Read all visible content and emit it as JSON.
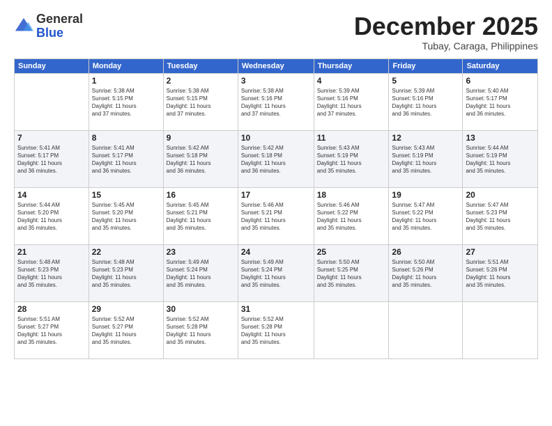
{
  "header": {
    "logo": {
      "general": "General",
      "blue": "Blue"
    },
    "title": "December 2025",
    "location": "Tubay, Caraga, Philippines"
  },
  "weekdays": [
    "Sunday",
    "Monday",
    "Tuesday",
    "Wednesday",
    "Thursday",
    "Friday",
    "Saturday"
  ],
  "weeks": [
    [
      {
        "day": "",
        "info": ""
      },
      {
        "day": "1",
        "info": "Sunrise: 5:38 AM\nSunset: 5:15 PM\nDaylight: 11 hours\nand 37 minutes."
      },
      {
        "day": "2",
        "info": "Sunrise: 5:38 AM\nSunset: 5:15 PM\nDaylight: 11 hours\nand 37 minutes."
      },
      {
        "day": "3",
        "info": "Sunrise: 5:38 AM\nSunset: 5:16 PM\nDaylight: 11 hours\nand 37 minutes."
      },
      {
        "day": "4",
        "info": "Sunrise: 5:39 AM\nSunset: 5:16 PM\nDaylight: 11 hours\nand 37 minutes."
      },
      {
        "day": "5",
        "info": "Sunrise: 5:39 AM\nSunset: 5:16 PM\nDaylight: 11 hours\nand 36 minutes."
      },
      {
        "day": "6",
        "info": "Sunrise: 5:40 AM\nSunset: 5:17 PM\nDaylight: 11 hours\nand 36 minutes."
      }
    ],
    [
      {
        "day": "7",
        "info": "Sunrise: 5:41 AM\nSunset: 5:17 PM\nDaylight: 11 hours\nand 36 minutes."
      },
      {
        "day": "8",
        "info": "Sunrise: 5:41 AM\nSunset: 5:17 PM\nDaylight: 11 hours\nand 36 minutes."
      },
      {
        "day": "9",
        "info": "Sunrise: 5:42 AM\nSunset: 5:18 PM\nDaylight: 11 hours\nand 36 minutes."
      },
      {
        "day": "10",
        "info": "Sunrise: 5:42 AM\nSunset: 5:18 PM\nDaylight: 11 hours\nand 36 minutes."
      },
      {
        "day": "11",
        "info": "Sunrise: 5:43 AM\nSunset: 5:19 PM\nDaylight: 11 hours\nand 35 minutes."
      },
      {
        "day": "12",
        "info": "Sunrise: 5:43 AM\nSunset: 5:19 PM\nDaylight: 11 hours\nand 35 minutes."
      },
      {
        "day": "13",
        "info": "Sunrise: 5:44 AM\nSunset: 5:19 PM\nDaylight: 11 hours\nand 35 minutes."
      }
    ],
    [
      {
        "day": "14",
        "info": "Sunrise: 5:44 AM\nSunset: 5:20 PM\nDaylight: 11 hours\nand 35 minutes."
      },
      {
        "day": "15",
        "info": "Sunrise: 5:45 AM\nSunset: 5:20 PM\nDaylight: 11 hours\nand 35 minutes."
      },
      {
        "day": "16",
        "info": "Sunrise: 5:45 AM\nSunset: 5:21 PM\nDaylight: 11 hours\nand 35 minutes."
      },
      {
        "day": "17",
        "info": "Sunrise: 5:46 AM\nSunset: 5:21 PM\nDaylight: 11 hours\nand 35 minutes."
      },
      {
        "day": "18",
        "info": "Sunrise: 5:46 AM\nSunset: 5:22 PM\nDaylight: 11 hours\nand 35 minutes."
      },
      {
        "day": "19",
        "info": "Sunrise: 5:47 AM\nSunset: 5:22 PM\nDaylight: 11 hours\nand 35 minutes."
      },
      {
        "day": "20",
        "info": "Sunrise: 5:47 AM\nSunset: 5:23 PM\nDaylight: 11 hours\nand 35 minutes."
      }
    ],
    [
      {
        "day": "21",
        "info": "Sunrise: 5:48 AM\nSunset: 5:23 PM\nDaylight: 11 hours\nand 35 minutes."
      },
      {
        "day": "22",
        "info": "Sunrise: 5:48 AM\nSunset: 5:23 PM\nDaylight: 11 hours\nand 35 minutes."
      },
      {
        "day": "23",
        "info": "Sunrise: 5:49 AM\nSunset: 5:24 PM\nDaylight: 11 hours\nand 35 minutes."
      },
      {
        "day": "24",
        "info": "Sunrise: 5:49 AM\nSunset: 5:24 PM\nDaylight: 11 hours\nand 35 minutes."
      },
      {
        "day": "25",
        "info": "Sunrise: 5:50 AM\nSunset: 5:25 PM\nDaylight: 11 hours\nand 35 minutes."
      },
      {
        "day": "26",
        "info": "Sunrise: 5:50 AM\nSunset: 5:26 PM\nDaylight: 11 hours\nand 35 minutes."
      },
      {
        "day": "27",
        "info": "Sunrise: 5:51 AM\nSunset: 5:26 PM\nDaylight: 11 hours\nand 35 minutes."
      }
    ],
    [
      {
        "day": "28",
        "info": "Sunrise: 5:51 AM\nSunset: 5:27 PM\nDaylight: 11 hours\nand 35 minutes."
      },
      {
        "day": "29",
        "info": "Sunrise: 5:52 AM\nSunset: 5:27 PM\nDaylight: 11 hours\nand 35 minutes."
      },
      {
        "day": "30",
        "info": "Sunrise: 5:52 AM\nSunset: 5:28 PM\nDaylight: 11 hours\nand 35 minutes."
      },
      {
        "day": "31",
        "info": "Sunrise: 5:52 AM\nSunset: 5:28 PM\nDaylight: 11 hours\nand 35 minutes."
      },
      {
        "day": "",
        "info": ""
      },
      {
        "day": "",
        "info": ""
      },
      {
        "day": "",
        "info": ""
      }
    ]
  ]
}
